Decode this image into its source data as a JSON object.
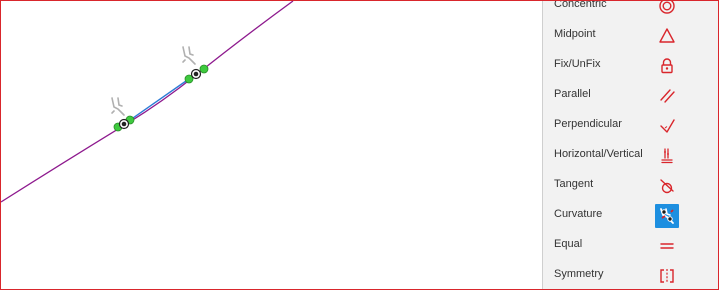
{
  "constraints_panel": {
    "items": [
      {
        "label": "Concentric",
        "icon": "concentric-icon"
      },
      {
        "label": "Midpoint",
        "icon": "midpoint-icon"
      },
      {
        "label": "Fix/UnFix",
        "icon": "lock-icon"
      },
      {
        "label": "Parallel",
        "icon": "parallel-icon"
      },
      {
        "label": "Perpendicular",
        "icon": "perpendicular-icon"
      },
      {
        "label": "Horizontal/Vertical",
        "icon": "horizontal-vertical-icon"
      },
      {
        "label": "Tangent",
        "icon": "tangent-icon"
      },
      {
        "label": "Curvature",
        "icon": "curvature-icon",
        "active": true
      },
      {
        "label": "Equal",
        "icon": "equal-icon"
      },
      {
        "label": "Symmetry",
        "icon": "symmetry-icon"
      }
    ]
  },
  "colors": {
    "accent_red": "#d9262c",
    "curve_purple": "#8e1a8e",
    "segment_blue": "#2b7bd6",
    "handle_green": "#3ec93e",
    "active_blue": "#1d8fe0"
  }
}
